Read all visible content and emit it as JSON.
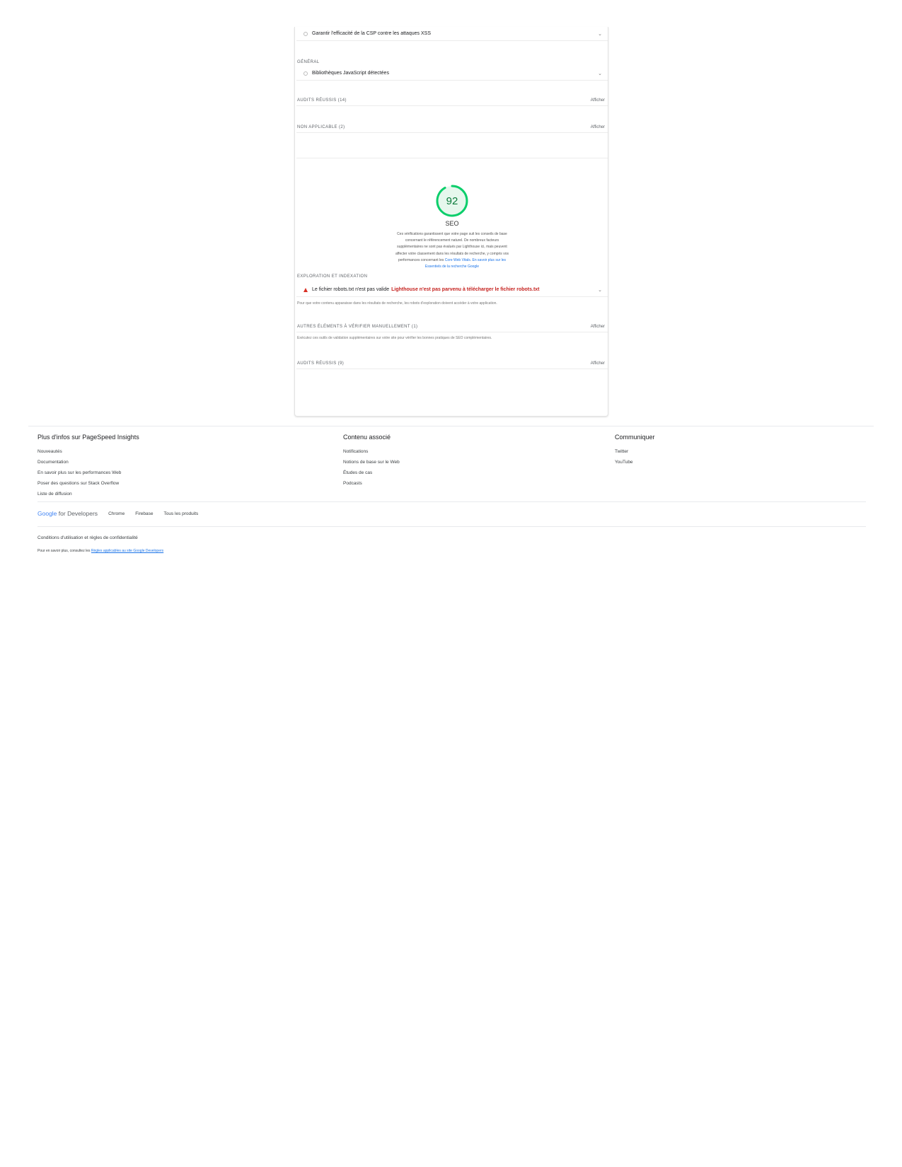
{
  "report": {
    "first_audit": "Garantir l'efficacité de la CSP contre les attaques XSS",
    "general_title": "GÉNÉRAL",
    "general_audit": "Bibliothèques JavaScript détectées",
    "passed_title": "AUDITS RÉUSSIS (14)",
    "not_applicable_title": "NON APPLICABLE (2)",
    "show_label": "Afficher",
    "chevron": "⌄"
  },
  "seo": {
    "score": "92",
    "score_color": "#0cce6b",
    "title": "SEO",
    "desc_line1": "Ces vérifications garantissent que votre page suit les conseils de base",
    "desc_line2": "concernant le référencement naturel. De nombreux facteurs",
    "desc_line3": "supplémentaires ne sont pas évalués par Lighthouse ici, mais peuvent",
    "desc_line4": "affecter votre classement dans les résultats de recherche, y compris vos",
    "desc_line5a": "performances concernant les ",
    "desc_link1": "Core Web Vitals",
    "desc_line5b": ". ",
    "desc_link2a": "En savoir plus sur les",
    "desc_link2b": "Essentiels de la recherche Google",
    "crawl_title": "EXPLORATION ET INDEXATION",
    "robots_label": "Le fichier robots.txt n'est pas valide",
    "robots_error": "Lighthouse n'est pas parvenu à télécharger le fichier robots.txt",
    "crawl_desc": "Pour que votre contenu apparaisse dans les résultats de recherche, les robots d'exploration doivent accéder à votre application.",
    "manual_title": "AUTRES ÉLÉMENTS À VÉRIFIER MANUELLEMENT (1)",
    "manual_desc": "Exécutez ces outils de validation supplémentaires sur votre site pour vérifier les bonnes pratiques de SEO complémentaires.",
    "passed_title": "AUDITS RÉUSSIS (9)"
  },
  "footer": {
    "col1": {
      "title": "Plus d'infos sur PageSpeed Insights",
      "links": [
        "Nouveautés",
        "Documentation",
        "En savoir plus sur les performances Web",
        "Poser des questions sur Stack Overflow",
        "Liste de diffusion"
      ]
    },
    "col2": {
      "title": "Contenu associé",
      "links": [
        "Notifications",
        "Notions de base sur le Web",
        "Études de cas",
        "Podcasts"
      ]
    },
    "col3": {
      "title": "Communiquer",
      "links": [
        "Twitter",
        "YouTube"
      ]
    },
    "brand_google": "Google",
    "brand_dev": " for Developers",
    "products": [
      "Chrome",
      "Firebase",
      "Tous les produits"
    ],
    "terms": "Conditions d'utilisation et règles de confidentialité",
    "policy_text": "Pour en savoir plus, consultez les ",
    "policy_link": "Règles applicables au site Google Developers"
  }
}
